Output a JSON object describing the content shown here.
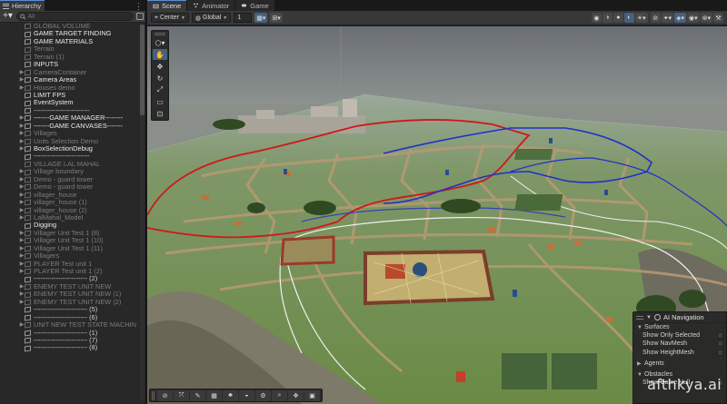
{
  "hierarchy": {
    "tab_label": "Hierarchy",
    "search_placeholder": "All",
    "items": [
      {
        "label": "GLOBAL VOLUME",
        "style": "faded",
        "arrow": ""
      },
      {
        "label": "GAME TARGET FINDING",
        "style": "white",
        "arrow": ""
      },
      {
        "label": "GAME  MATERIALS",
        "style": "white",
        "arrow": ""
      },
      {
        "label": "Terrain",
        "style": "faded",
        "arrow": ""
      },
      {
        "label": "Terrain (1)",
        "style": "faded",
        "arrow": ""
      },
      {
        "label": "INPUTS",
        "style": "white",
        "arrow": ""
      },
      {
        "label": "CameraContainer",
        "style": "faded",
        "arrow": "▶"
      },
      {
        "label": "Camera Areas",
        "style": "white",
        "arrow": "▶"
      },
      {
        "label": "Houses demo",
        "style": "faded",
        "arrow": "▶"
      },
      {
        "label": "LIMIT FPS",
        "style": "white",
        "arrow": ""
      },
      {
        "label": "EventSystem",
        "style": "white",
        "arrow": ""
      },
      {
        "label": "-------------------------",
        "style": "normal",
        "arrow": ""
      },
      {
        "label": "-------GAME MANAGER--------",
        "style": "white",
        "arrow": "▶"
      },
      {
        "label": "-------GAME CANVASES-------",
        "style": "white",
        "arrow": "▶"
      },
      {
        "label": "Villages",
        "style": "faded",
        "arrow": "▶"
      },
      {
        "label": "Units Selection Demo",
        "style": "faded",
        "arrow": "▶"
      },
      {
        "label": "BoxSelectionDebug",
        "style": "white",
        "arrow": "▶"
      },
      {
        "label": "-------------------------",
        "style": "normal",
        "arrow": ""
      },
      {
        "label": "VILLAGE LAL MAHAL",
        "style": "faded",
        "arrow": ""
      },
      {
        "label": "Village  boundary",
        "style": "faded",
        "arrow": "▶"
      },
      {
        "label": "Demo - guard tower",
        "style": "faded",
        "arrow": "▶"
      },
      {
        "label": "Demo - guard tower",
        "style": "faded",
        "arrow": "▶"
      },
      {
        "label": "villager_house",
        "style": "faded",
        "arrow": "▶"
      },
      {
        "label": "villager_house (1)",
        "style": "faded",
        "arrow": "▶"
      },
      {
        "label": "villager_house (2)",
        "style": "faded",
        "arrow": "▶"
      },
      {
        "label": "LalMahal_Model",
        "style": "faded",
        "arrow": "▶"
      },
      {
        "label": "Digging",
        "style": "white",
        "arrow": ""
      },
      {
        "label": "Villager Unit Test 1 (8)",
        "style": "faded",
        "arrow": "▶"
      },
      {
        "label": "Villager Unit Test 1 (10)",
        "style": "faded",
        "arrow": "▶"
      },
      {
        "label": "Villager Unit Test 1 (11)",
        "style": "faded",
        "arrow": "▶"
      },
      {
        "label": "Villagers",
        "style": "faded",
        "arrow": "▶"
      },
      {
        "label": "PLAYER  Test unit 1",
        "style": "faded",
        "arrow": "▶"
      },
      {
        "label": "PLAYER  Test unit 1 (2)",
        "style": "faded",
        "arrow": "▶"
      },
      {
        "label": "------------------------ (2)",
        "style": "normal",
        "arrow": ""
      },
      {
        "label": "ENEMY TEST UNIT NEW",
        "style": "faded",
        "arrow": "▶"
      },
      {
        "label": "ENEMY TEST UNIT NEW (1)",
        "style": "faded",
        "arrow": "▶"
      },
      {
        "label": "ENEMY TEST UNIT NEW (2)",
        "style": "faded",
        "arrow": "▶"
      },
      {
        "label": "------------------------ (5)",
        "style": "normal",
        "arrow": ""
      },
      {
        "label": "------------------------ (6)",
        "style": "normal",
        "arrow": ""
      },
      {
        "label": "UNIT NEW TEST STATE MACHIN",
        "style": "faded",
        "arrow": "▶"
      },
      {
        "label": "------------------------ (1)",
        "style": "normal",
        "arrow": ""
      },
      {
        "label": "------------------------ (7)",
        "style": "normal",
        "arrow": ""
      },
      {
        "label": "------------------------ (8)",
        "style": "normal",
        "arrow": ""
      }
    ]
  },
  "scene_tabs": {
    "scene": "Scene",
    "animator": "Animator",
    "game": "Game"
  },
  "scene_toolbar": {
    "pivot": "Center",
    "space": "Global",
    "snap_increment": "1"
  },
  "ai_navigation": {
    "title": "AI Navigation",
    "surfaces": "Surfaces",
    "show_only_selected": "Show Only Selected",
    "show_navmesh": "Show NavMesh",
    "show_heightmesh": "Show HeightMesh",
    "agents": "Agents",
    "obstacles": "Obstacles",
    "show_carve_hull": "Show Carve Hull"
  },
  "watermark": "afthkya.ai",
  "colors": {
    "accent": "#46607f",
    "red_boundary": "#d01818",
    "blue_boundary": "#2030c8",
    "white_boundary": "#f0f0f0",
    "grass": "#6f8f4d"
  }
}
